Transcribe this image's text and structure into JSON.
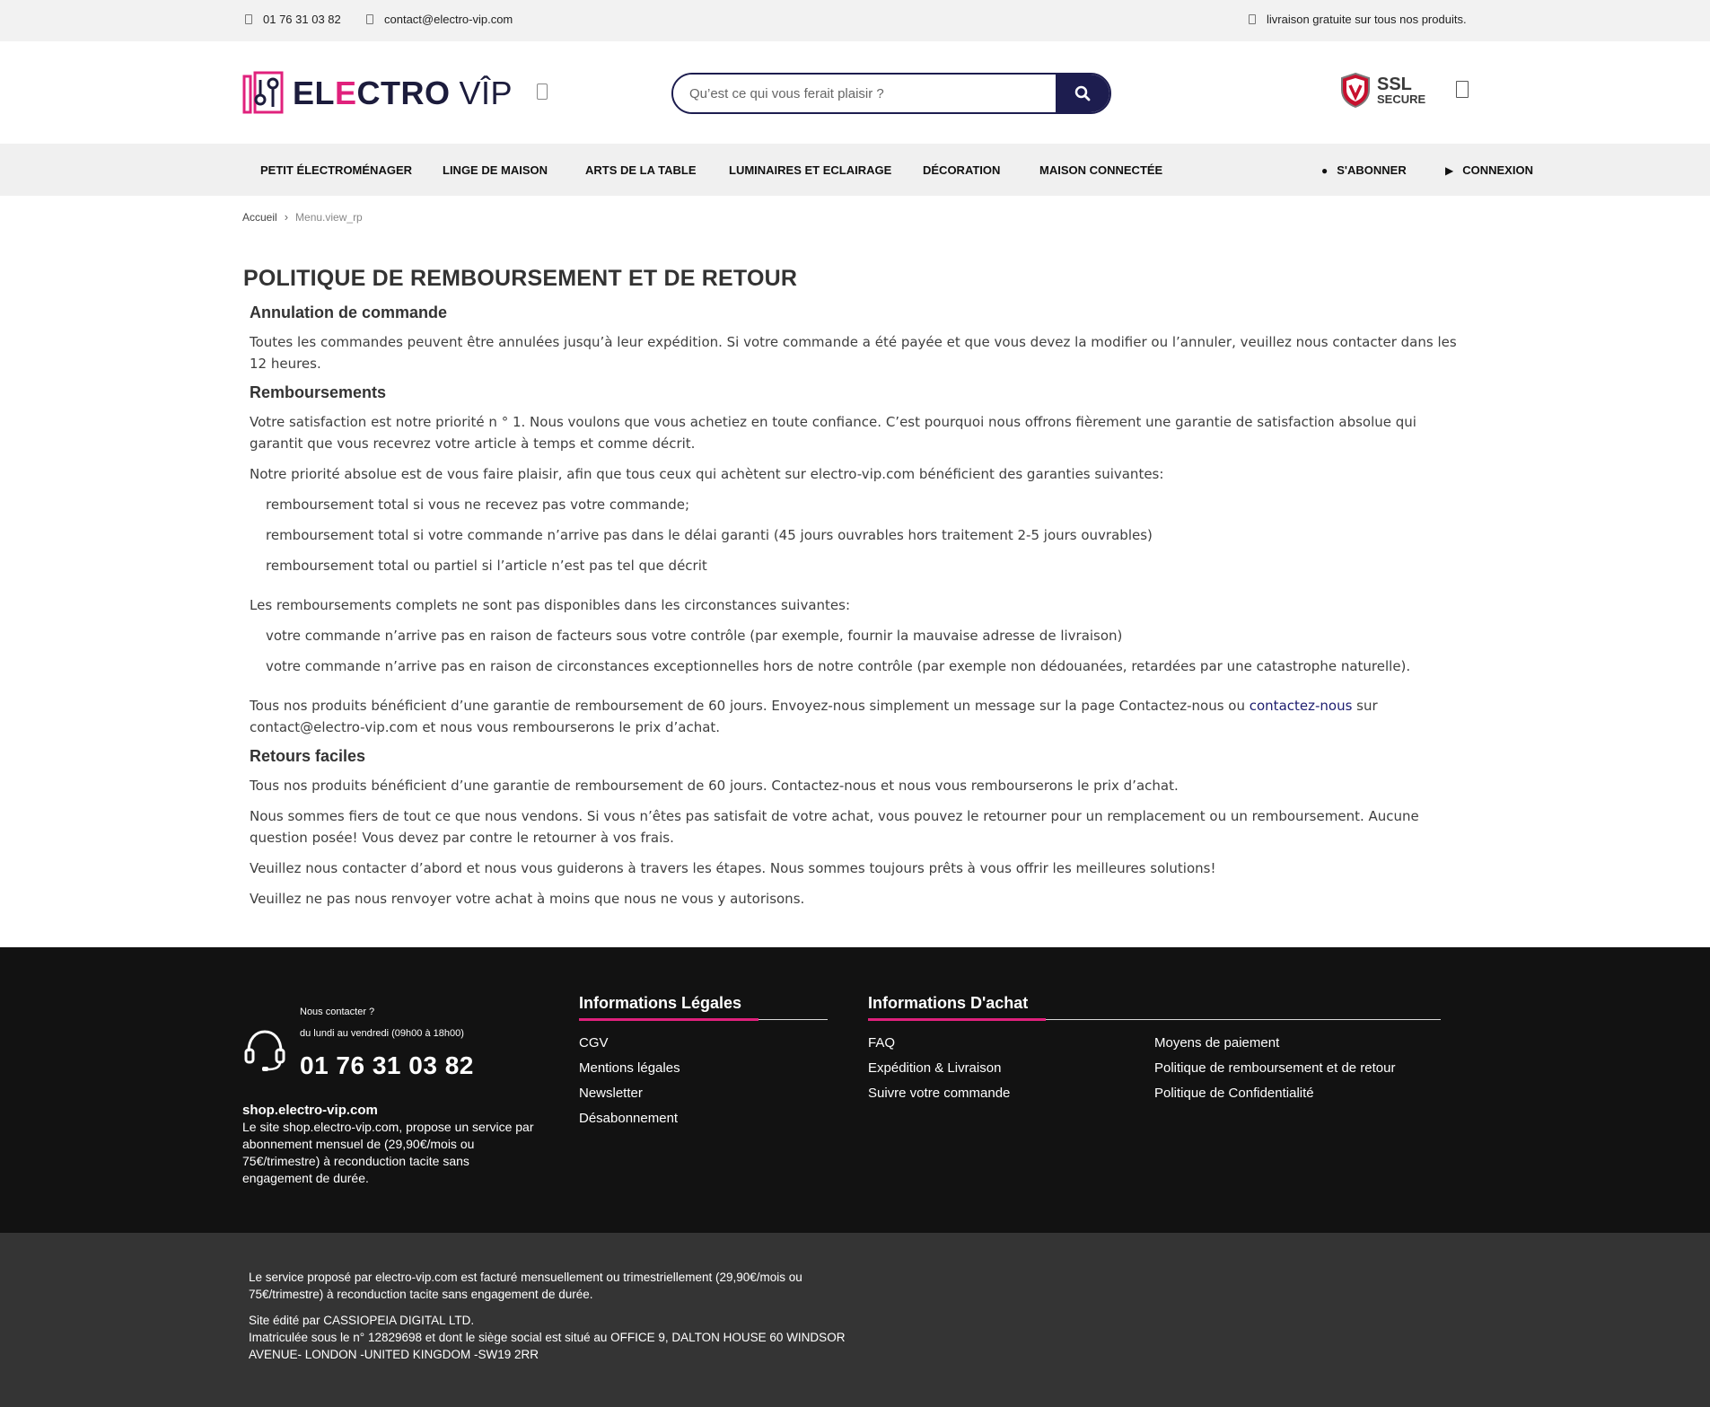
{
  "topbar": {
    "phone": "01 76 31 03 82",
    "email": "contact@electro-vip.com",
    "shipping": "livraison gratuite sur tous nos produits."
  },
  "header": {
    "logo_part1": "EL",
    "logo_part2": "E",
    "logo_part3": "CTRO",
    "logo_vip": "VÎP",
    "search_placeholder": "Qu’est ce qui vous ferait plaisir ?",
    "ssl_big": "SSL",
    "ssl_small": "SECURE"
  },
  "nav": {
    "items": [
      "PETIT ÉLECTROMÉNAGER",
      "LINGE DE MAISON",
      "ARTS DE LA TABLE",
      "LUMINAIRES ET ECLAIRAGE",
      "DÉCORATION",
      "MAISON CONNECTÉE"
    ],
    "subscribe": "S'ABONNER",
    "login": "CONNEXION"
  },
  "breadcrumb": {
    "home": "Accueil",
    "current": "Menu.view_rp"
  },
  "main": {
    "title": "POLITIQUE DE REMBOURSEMENT ET DE RETOUR",
    "h_annulation": "Annulation de commande",
    "p_annulation": "Toutes les commandes peuvent être annulées jusqu’à leur expédition. Si votre commande a été payée et que vous devez la modifier ou l’annuler, veuillez nous contacter dans les 12 heures.",
    "h_remb": "Remboursements",
    "p_remb1": "Votre satisfaction est notre priorité n ° 1. Nous voulons que vous achetiez en toute confiance. C’est pourquoi nous offrons fièrement une garantie de satisfaction absolue qui garantit que vous recevrez votre article à temps et comme décrit.",
    "p_remb2": "Notre priorité absolue est de vous faire plaisir, afin que tous ceux qui achètent sur electro-vip.com bénéficient des garanties suivantes:",
    "list1": [
      "remboursement total si vous ne recevez pas votre commande;",
      "remboursement total si votre commande n’arrive pas dans le délai garanti (45 jours ouvrables hors traitement 2-5 jours ouvrables)",
      "remboursement total ou partiel si l’article n’est pas tel que décrit"
    ],
    "p_remb3": "Les remboursements complets ne sont pas disponibles dans les circonstances suivantes:",
    "list2": [
      "votre commande n’arrive pas en raison de facteurs sous votre contrôle (par exemple, fournir la mauvaise adresse de livraison)",
      "votre commande n’arrive pas en raison de circonstances exceptionnelles hors de notre contrôle (par exemple non dédouanées, retardées par une catastrophe naturelle)."
    ],
    "p_remb4_a": "Tous nos produits bénéficient d’une garantie de remboursement de 60 jours. Envoyez-nous simplement un message sur la page Contactez-nous ou ",
    "p_remb4_link": "contactez-nous",
    "p_remb4_b": " sur contact@electro-vip.com et nous vous rembourserons le prix d’achat.",
    "h_retours": "Retours faciles",
    "p_ret1": "Tous nos produits bénéficient d’une garantie de remboursement de 60 jours. Contactez-nous et nous vous rembourserons le prix d’achat.",
    "p_ret2": "Nous sommes fiers de tout ce que nous vendons. Si vous n’êtes pas satisfait de votre achat, vous pouvez le retourner pour un remplacement ou un remboursement. Aucune question posée! Vous devez par contre le retourner à vos frais.",
    "p_ret3": "Veuillez nous contacter d’abord et nous vous guiderons à travers les étapes. Nous sommes toujours prêts à vous offrir les meilleures solutions!",
    "p_ret4": "Veuillez ne pas nous renvoyer votre achat à moins que nous ne vous y autorisons."
  },
  "footer": {
    "contact_label": "Nous contacter ?",
    "hours": "du lundi au vendredi (09h00 à 18h00)",
    "phone": "01 76 31 03 82",
    "site": "shop.electro-vip.com",
    "site_desc": "Le site shop.electro-vip.com, propose un service par abonnement mensuel de (29,90€/mois ou 75€/trimestre) à reconduction tacite sans engagement de durée.",
    "legal_title": "Informations Légales",
    "legal_links": [
      "CGV",
      "Mentions légales",
      "Newsletter",
      "Désabonnement"
    ],
    "purchase_title": "Informations D'achat",
    "purchase_links_col1": [
      "FAQ",
      "Expédition & Livraison",
      "Suivre votre commande"
    ],
    "purchase_links_col2": [
      "Moyens de paiement",
      "Politique de remboursement et de retour",
      "Politique de Confidentialité"
    ],
    "bottom_p1": "Le service proposé par electro-vip.com est facturé mensuellement ou trimestriellement (29,90€/mois ou 75€/trimestre) à reconduction tacite sans engagement de durée.",
    "bottom_p2a": "Site édité par CASSIOPEIA DIGITAL LTD.",
    "bottom_p2b": "Imatriculée sous le n° 12829698 et dont le siège social est situé au  OFFICE 9, DALTON HOUSE 60 WINDSOR AVENUE- LONDON -UNITED KINGDOM -SW19 2RR"
  },
  "colors": {
    "brand_navy": "#1d1d4f",
    "brand_pink": "#e0217c",
    "footer_bg": "#121212",
    "bottom_bg": "#343434"
  }
}
